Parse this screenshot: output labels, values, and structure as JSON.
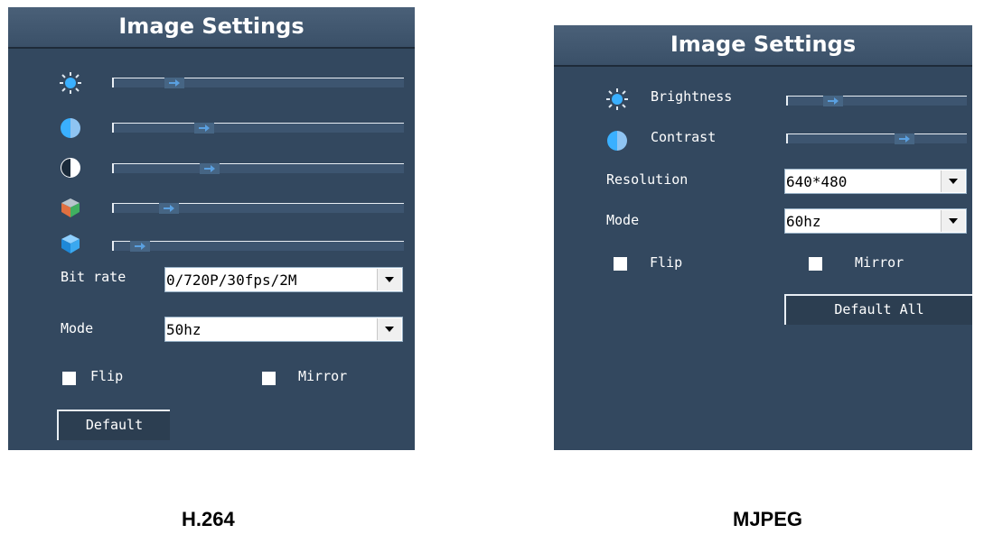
{
  "h264_panel": {
    "title": "Image Settings",
    "sliders": [
      {
        "icon": "sun-icon",
        "value_percent": 21
      },
      {
        "icon": "half-circle-icon",
        "value_percent": 31
      },
      {
        "icon": "contrast-circle-icon",
        "value_percent": 33
      },
      {
        "icon": "color-cube-icon",
        "value_percent": 19
      },
      {
        "icon": "blue-cube-icon",
        "value_percent": 9
      }
    ],
    "bitrate_label": "Bit rate",
    "bitrate_value": "0/720P/30fps/2M",
    "mode_label": "Mode",
    "mode_value": "50hz",
    "flip_label": "Flip",
    "mirror_label": "Mirror",
    "default_label": "Default"
  },
  "mjpeg_panel": {
    "title": "Image Settings",
    "brightness_label": "Brightness",
    "brightness_value_percent": 25,
    "contrast_label": "Contrast",
    "contrast_value_percent": 65,
    "resolution_label": "Resolution",
    "resolution_value": "640*480",
    "mode_label": "Mode",
    "mode_value": "60hz",
    "flip_label": "Flip",
    "mirror_label": "Mirror",
    "default_all_label": "Default All"
  },
  "captions": {
    "left": "H.264",
    "right": "MJPEG"
  },
  "colors": {
    "panel_bg": "#33485f",
    "header_bg": "#4a6078",
    "thumb_arrow": "#5aa0e0"
  }
}
